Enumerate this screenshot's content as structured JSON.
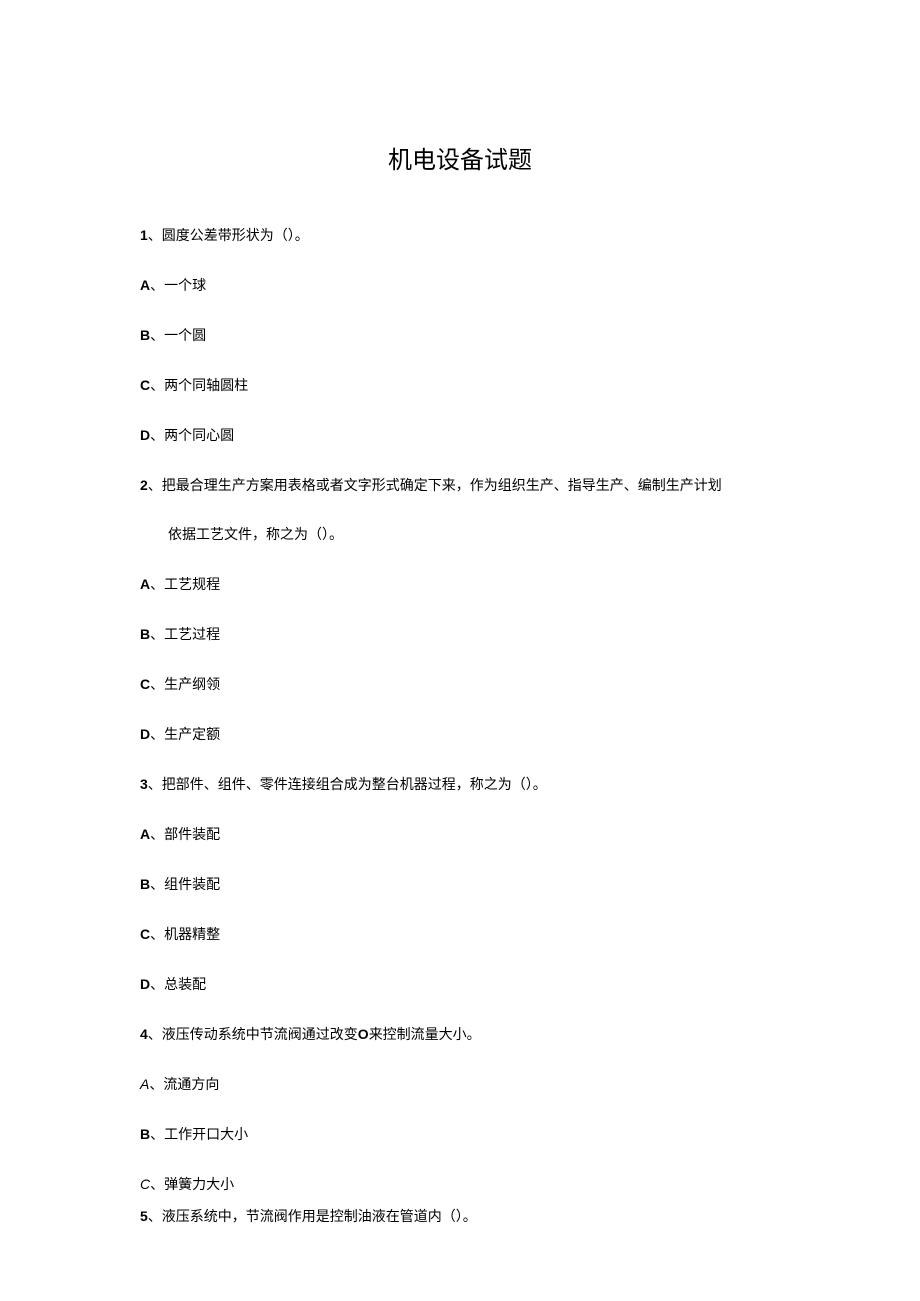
{
  "title": "机电设备试题",
  "q1": {
    "num": "1",
    "text": "、圆度公差带形状为（）。",
    "a": "、一个球",
    "b": "、一个圆",
    "c": "、两个同轴圆柱",
    "d": "、两个同心圆"
  },
  "q2": {
    "num": "2",
    "text": "、把最合理生产方案用表格或者文字形式确定下来，作为组织生产、指导生产、编制生产计划",
    "text2": "依据工艺文件，称之为（）。",
    "a": "、工艺规程",
    "b": "、工艺过程",
    "c": "、生产纲领",
    "d": "、生产定额"
  },
  "q3": {
    "num": "3",
    "text": "、把部件、组件、零件连接组合成为整台机器过程，称之为（）。",
    "a": "、部件装配",
    "b": "、组件装配",
    "c": "、机器精整",
    "d": "、总装配"
  },
  "q4": {
    "num": "4",
    "text_a": "、液压传动系统中节流阀通过改变",
    "text_b": "O",
    "text_c": "来控制流量大小。",
    "a": "、流通方向",
    "b": "、工作开口大小",
    "c": "、弹簧力大小"
  },
  "q5": {
    "num": "5",
    "text": "、液压系统中，节流阀作用是控制油液在管道内（）。"
  },
  "labels": {
    "A": "A",
    "B": "B",
    "C": "C",
    "D": "D"
  }
}
